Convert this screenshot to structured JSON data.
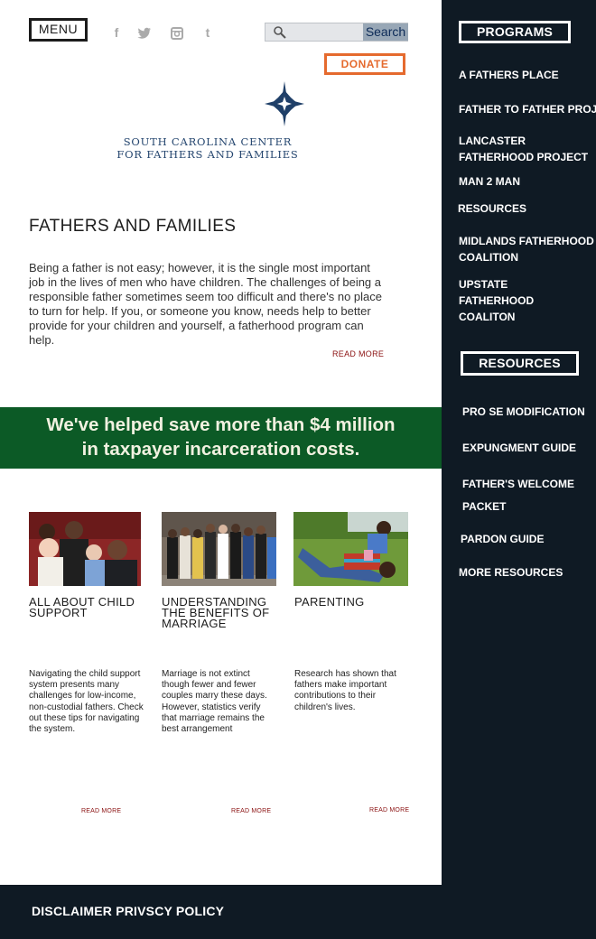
{
  "header": {
    "menu_label": "MENU",
    "social_icons": [
      "facebook-icon",
      "twitter-icon",
      "instagram-icon",
      "tumblr-icon"
    ],
    "search": {
      "placeholder": "",
      "button_label": "Search"
    },
    "donate_label": "DONATE"
  },
  "logo": {
    "line1": "SOUTH CAROLINA CENTER",
    "line2": "FOR FATHERS AND FAMILIES"
  },
  "intro": {
    "title": "FATHERS AND FAMILIES",
    "text": "Being a father is not easy; however, it is the single most important job in the lives of men who have children. The challenges of being a responsible father sometimes seem too difficult and there's no place to turn for help. If you, or someone you know, needs help to better provide for your children and yourself, a fatherhood program can help.",
    "read_more": "READ MORE"
  },
  "banner": {
    "line1": "We've helped save more than $4 million",
    "line2": "in taxpayer incarceration costs."
  },
  "cards": [
    {
      "title": "ALL ABOUT CHILD SUPPORT",
      "text": "Navigating the child support system presents many challenges for low-income, non-custodial fathers. Check out these tips for navigating the system.",
      "read_more": "READ MORE"
    },
    {
      "title": "UNDERSTANDING THE BENEFITS OF MARRIAGE",
      "text": "Marriage is not extinct though fewer and fewer couples marry these days. However, statistics verify that marriage remains the best arrangement",
      "read_more": "READ MORE"
    },
    {
      "title": "PARENTING",
      "text": "Research has shown that fathers make important contributions to their children's lives.",
      "read_more": "READ MORE"
    }
  ],
  "sidebar": {
    "programs_heading": "PROGRAMS",
    "programs": [
      "A FATHERS PLACE",
      "FATHER TO FATHER PROJECT",
      "LANCASTER FATHERHOOD PROJECT",
      "MAN 2 MAN",
      "RESOURCES",
      "MIDLANDS FATHERHOOD COALITION",
      "UPSTATE FATHERHOOD COALITON"
    ],
    "resources_heading": "RESOURCES",
    "resources": [
      "PRO SE MODIFICATION",
      "EXPUNGMENT GUIDE",
      "FATHER'S WELCOME PACKET",
      "PARDON GUIDE",
      "MORE RESOURCES"
    ]
  },
  "footer": {
    "links": "DISCLAIMER PRIVSCY POLICY"
  },
  "colors": {
    "sidebar_bg": "#0f1a24",
    "banner_green": "#0c5a26",
    "donate_orange": "#e56a2e",
    "logo_navy": "#25466f",
    "read_more_red": "#8a1010"
  }
}
